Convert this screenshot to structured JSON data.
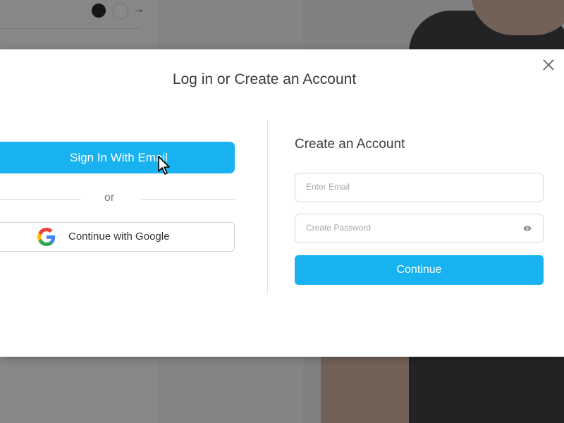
{
  "modal": {
    "title": "Log in or Create an Account",
    "close_icon": "close-icon"
  },
  "left": {
    "email_button_label": "Sign In With Email",
    "or_text": "or",
    "google_button_label": "Continue with Google",
    "google_icon": "google-logo-icon"
  },
  "right": {
    "title": "Create an Account",
    "email_placeholder": "Enter Email",
    "password_placeholder": "Create Password",
    "password_toggle_icon": "eye-icon",
    "continue_label": "Continue"
  },
  "background": {
    "color_swatches": [
      "#000000",
      "#ffffff"
    ],
    "next_icon": "arrow-right-icon"
  },
  "colors": {
    "accent": "#17b2ef"
  }
}
